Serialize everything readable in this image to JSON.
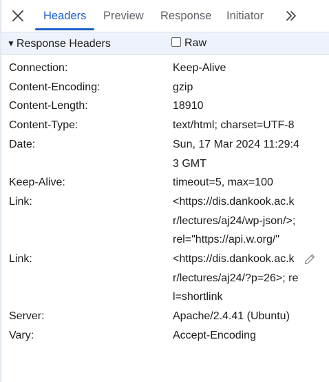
{
  "tabs": [
    {
      "label": "Headers",
      "active": true
    },
    {
      "label": "Preview",
      "active": false
    },
    {
      "label": "Response",
      "active": false
    },
    {
      "label": "Initiator",
      "active": false
    }
  ],
  "icons": {
    "close": "close-icon",
    "more": "chevron-double-right-icon",
    "edit": "pencil-icon"
  },
  "colors": {
    "accent": "#1a5fc9",
    "section_bg": "#eef2fa"
  },
  "section": {
    "title": "Response Headers",
    "expanded": true,
    "raw_label": "Raw",
    "raw_checked": false
  },
  "headers": [
    {
      "name": "Connection:",
      "value": "Keep-Alive"
    },
    {
      "name": "Content-Encoding:",
      "value": "gzip"
    },
    {
      "name": "Content-Length:",
      "value": "18910"
    },
    {
      "name": "Content-Type:",
      "value": "text/html; charset=UTF-8"
    },
    {
      "name": "Date:",
      "value": "Sun, 17 Mar 2024 11:29:43 GMT"
    },
    {
      "name": "Keep-Alive:",
      "value": "timeout=5, max=100"
    },
    {
      "name": "Link:",
      "value": "<https://dis.dankook.ac.kr/lectures/aj24/wp-json/>; rel=\"https://api.w.org/\""
    },
    {
      "name": "Link:",
      "value": "<https://dis.dankook.ac.kr/lectures/aj24/?p=26>; rel=shortlink"
    },
    {
      "name": "Server:",
      "value": "Apache/2.4.41 (Ubuntu)"
    },
    {
      "name": "Vary:",
      "value": "Accept-Encoding"
    }
  ]
}
